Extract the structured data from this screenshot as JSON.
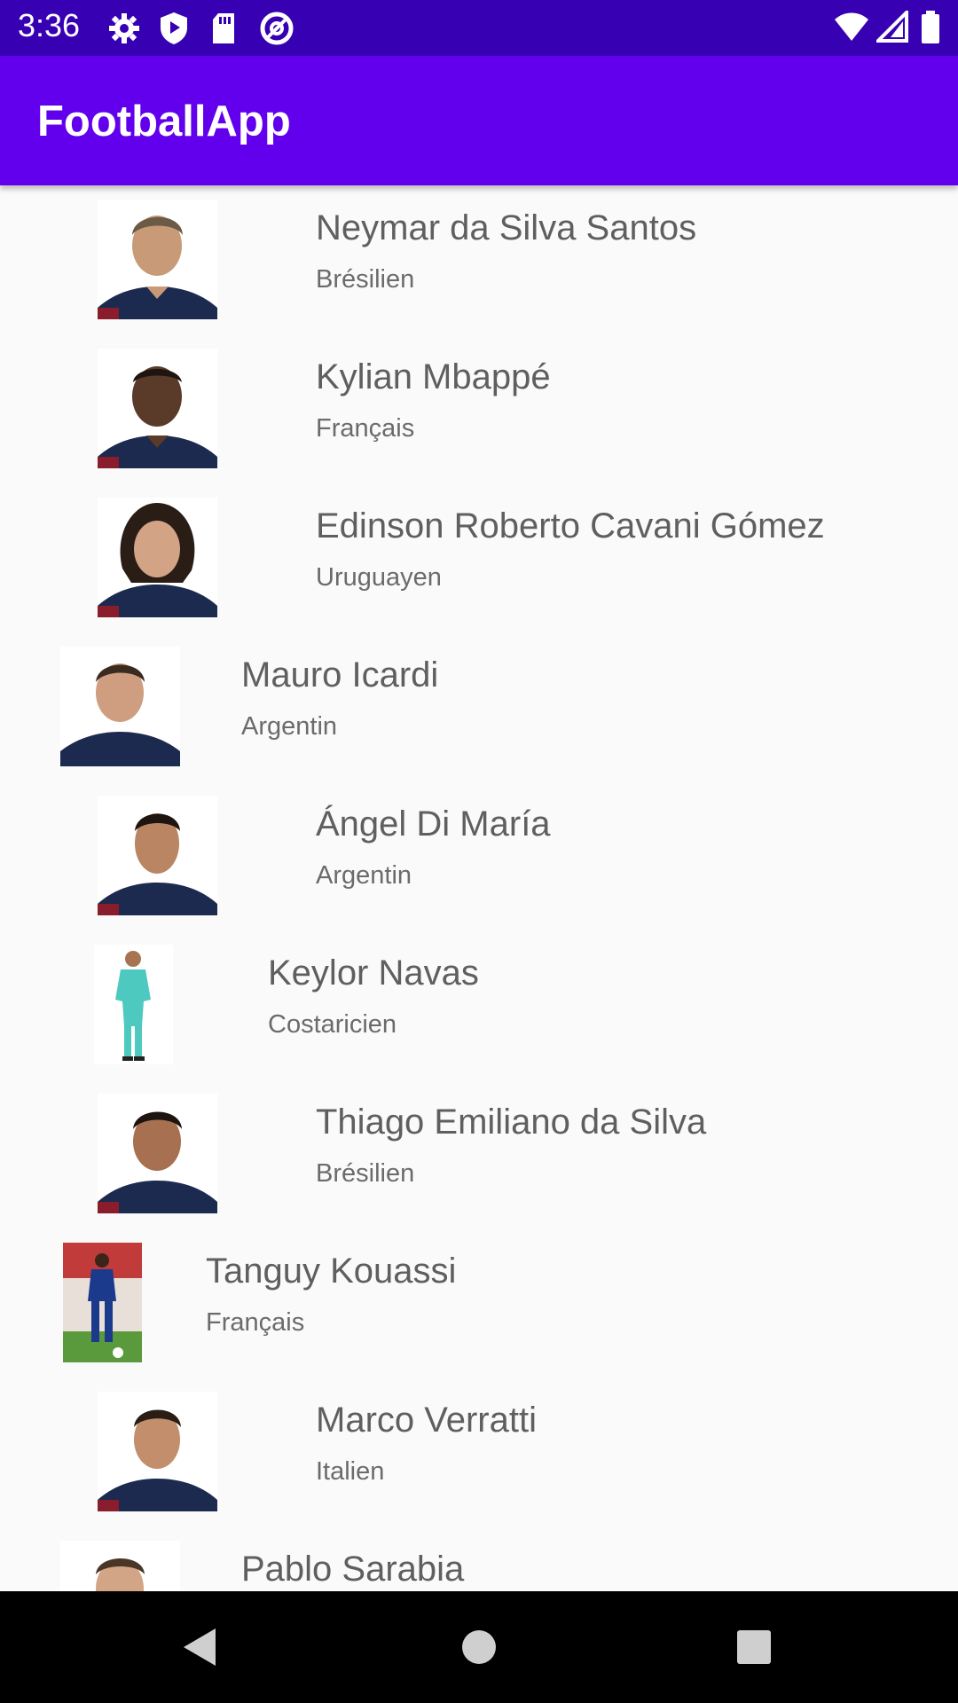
{
  "status_bar": {
    "time": "3:36",
    "left_icons": [
      "settings-icon",
      "play-protect-icon",
      "sd-card-icon",
      "at-sign-icon"
    ],
    "right_icons": [
      "wifi-icon",
      "signal-icon",
      "battery-icon"
    ]
  },
  "app_bar": {
    "title": "FootballApp",
    "color": "#6200ee"
  },
  "players": [
    {
      "name": "Neymar da Silva Santos",
      "nationality": "Brésilien",
      "photo": "portrait-photo"
    },
    {
      "name": "Kylian Mbappé",
      "nationality": "Français",
      "photo": "portrait-photo"
    },
    {
      "name": "Edinson Roberto Cavani Gómez",
      "nationality": "Uruguayen",
      "photo": "portrait-photo"
    },
    {
      "name": "Mauro Icardi",
      "nationality": "Argentin",
      "photo": "portrait-photo"
    },
    {
      "name": "Ángel Di María",
      "nationality": "Argentin",
      "photo": "portrait-photo"
    },
    {
      "name": "Keylor Navas",
      "nationality": "Costaricien",
      "photo": "full-body-photo"
    },
    {
      "name": "Thiago Emiliano da Silva",
      "nationality": "Brésilien",
      "photo": "portrait-photo"
    },
    {
      "name": "Tanguy Kouassi",
      "nationality": "Français",
      "photo": "action-photo"
    },
    {
      "name": "Marco Verratti",
      "nationality": "Italien",
      "photo": "portrait-photo"
    },
    {
      "name": "Pablo Sarabia",
      "nationality": "",
      "photo": "portrait-photo"
    }
  ],
  "nav_bar": {
    "buttons": [
      "back-icon",
      "home-icon",
      "recents-icon"
    ]
  }
}
